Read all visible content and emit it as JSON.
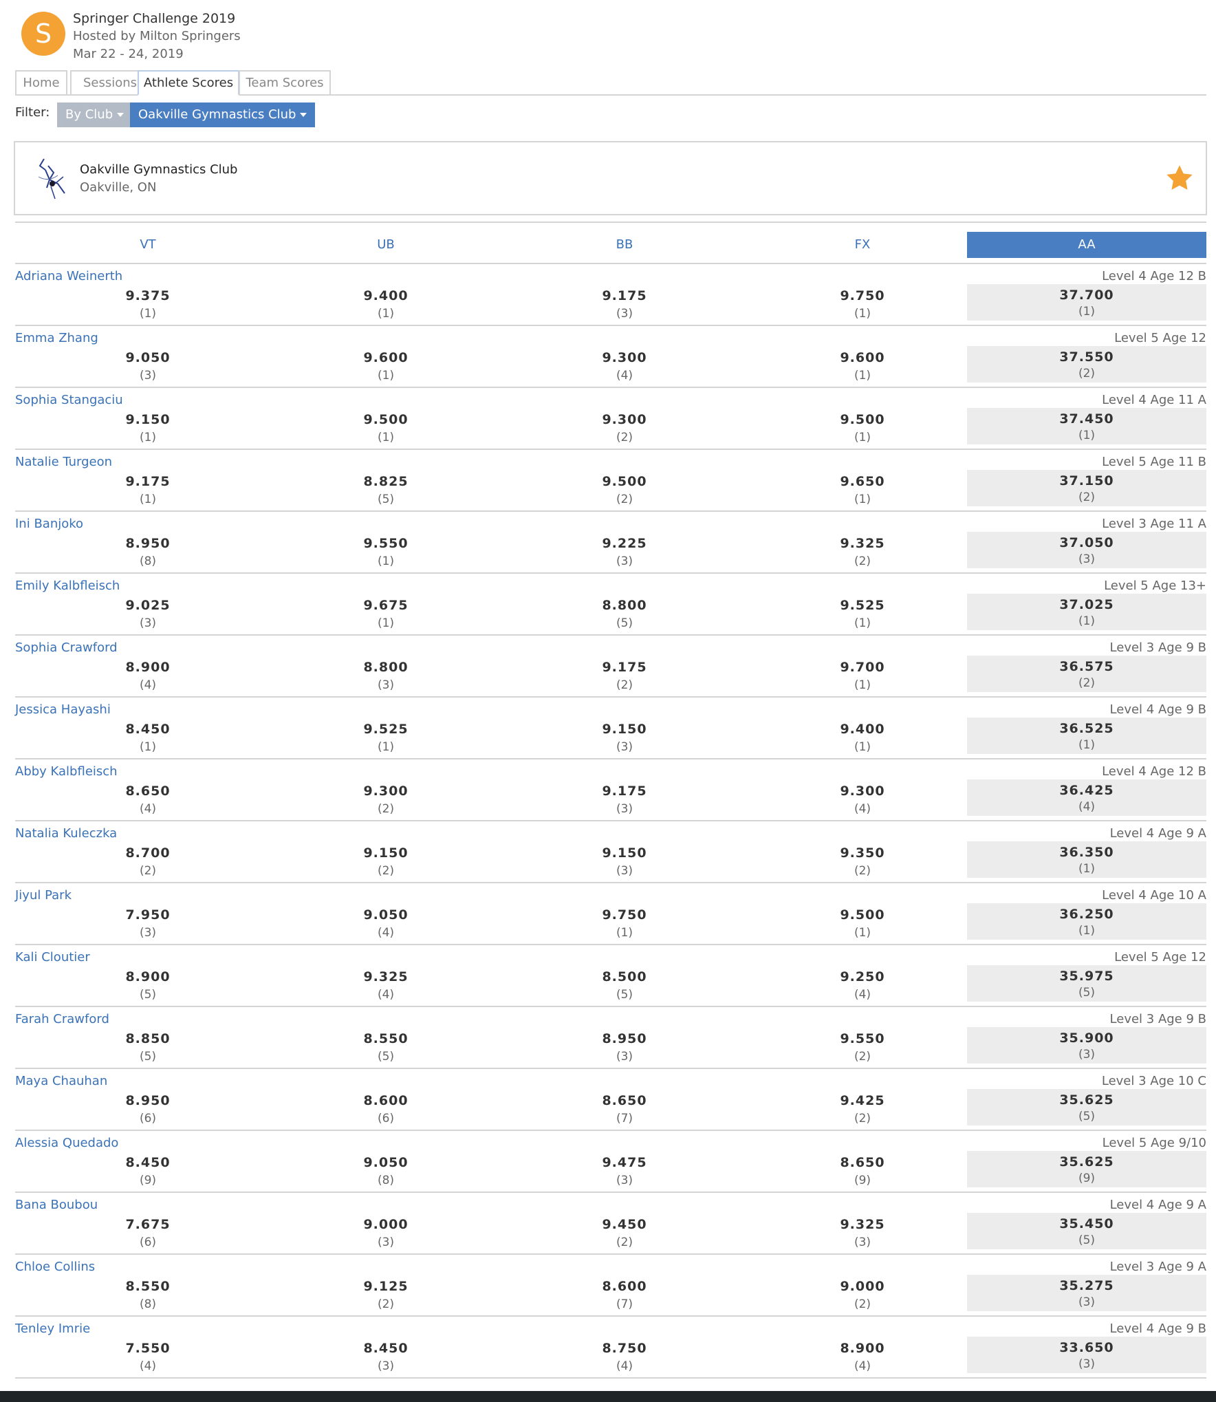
{
  "meet": {
    "logo_letter": "S",
    "title": "Springer Challenge 2019",
    "host": "Hosted by Milton Springers",
    "dates": "Mar 22 - 24, 2019"
  },
  "tabs": [
    {
      "label": "Home",
      "active": false
    },
    {
      "label": "Sessions",
      "active": false
    },
    {
      "label": "Athlete Scores",
      "active": true
    },
    {
      "label": "Team Scores",
      "active": false
    }
  ],
  "filter": {
    "label": "Filter:",
    "by": "By Club",
    "club": "Oakville Gymnastics Club"
  },
  "club": {
    "name": "Oakville Gymnastics Club",
    "location": "Oakville, ON",
    "favorite": true
  },
  "columns": [
    "VT",
    "UB",
    "BB",
    "FX",
    "AA"
  ],
  "colors": {
    "accent": "#4a7ec2",
    "link": "#3a72b8",
    "star": "#f3a233",
    "logo": "#f3a233"
  },
  "athletes": [
    {
      "name": "Adriana Weinerth",
      "level": "Level 4 Age 12 B",
      "scores": [
        [
          "9.375",
          "(1)"
        ],
        [
          "9.400",
          "(1)"
        ],
        [
          "9.175",
          "(3)"
        ],
        [
          "9.750",
          "(1)"
        ],
        [
          "37.700",
          "(1)"
        ]
      ]
    },
    {
      "name": "Emma Zhang",
      "level": "Level 5 Age 12",
      "scores": [
        [
          "9.050",
          "(3)"
        ],
        [
          "9.600",
          "(1)"
        ],
        [
          "9.300",
          "(4)"
        ],
        [
          "9.600",
          "(1)"
        ],
        [
          "37.550",
          "(2)"
        ]
      ]
    },
    {
      "name": "Sophia Stangaciu",
      "level": "Level 4 Age 11 A",
      "scores": [
        [
          "9.150",
          "(1)"
        ],
        [
          "9.500",
          "(1)"
        ],
        [
          "9.300",
          "(2)"
        ],
        [
          "9.500",
          "(1)"
        ],
        [
          "37.450",
          "(1)"
        ]
      ]
    },
    {
      "name": "Natalie Turgeon",
      "level": "Level 5 Age 11 B",
      "scores": [
        [
          "9.175",
          "(1)"
        ],
        [
          "8.825",
          "(5)"
        ],
        [
          "9.500",
          "(2)"
        ],
        [
          "9.650",
          "(1)"
        ],
        [
          "37.150",
          "(2)"
        ]
      ]
    },
    {
      "name": "Ini Banjoko",
      "level": "Level 3 Age 11 A",
      "scores": [
        [
          "8.950",
          "(8)"
        ],
        [
          "9.550",
          "(1)"
        ],
        [
          "9.225",
          "(3)"
        ],
        [
          "9.325",
          "(2)"
        ],
        [
          "37.050",
          "(3)"
        ]
      ]
    },
    {
      "name": "Emily Kalbfleisch",
      "level": "Level 5 Age 13+",
      "scores": [
        [
          "9.025",
          "(3)"
        ],
        [
          "9.675",
          "(1)"
        ],
        [
          "8.800",
          "(5)"
        ],
        [
          "9.525",
          "(1)"
        ],
        [
          "37.025",
          "(1)"
        ]
      ]
    },
    {
      "name": "Sophia Crawford",
      "level": "Level 3 Age 9 B",
      "scores": [
        [
          "8.900",
          "(4)"
        ],
        [
          "8.800",
          "(3)"
        ],
        [
          "9.175",
          "(2)"
        ],
        [
          "9.700",
          "(1)"
        ],
        [
          "36.575",
          "(2)"
        ]
      ]
    },
    {
      "name": "Jessica Hayashi",
      "level": "Level 4 Age 9 B",
      "scores": [
        [
          "8.450",
          "(1)"
        ],
        [
          "9.525",
          "(1)"
        ],
        [
          "9.150",
          "(3)"
        ],
        [
          "9.400",
          "(1)"
        ],
        [
          "36.525",
          "(1)"
        ]
      ]
    },
    {
      "name": "Abby Kalbfleisch",
      "level": "Level 4 Age 12 B",
      "scores": [
        [
          "8.650",
          "(4)"
        ],
        [
          "9.300",
          "(2)"
        ],
        [
          "9.175",
          "(3)"
        ],
        [
          "9.300",
          "(4)"
        ],
        [
          "36.425",
          "(4)"
        ]
      ]
    },
    {
      "name": "Natalia Kuleczka",
      "level": "Level 4 Age 9 A",
      "scores": [
        [
          "8.700",
          "(2)"
        ],
        [
          "9.150",
          "(2)"
        ],
        [
          "9.150",
          "(3)"
        ],
        [
          "9.350",
          "(2)"
        ],
        [
          "36.350",
          "(1)"
        ]
      ]
    },
    {
      "name": "Jiyul Park",
      "level": "Level 4 Age 10 A",
      "scores": [
        [
          "7.950",
          "(3)"
        ],
        [
          "9.050",
          "(4)"
        ],
        [
          "9.750",
          "(1)"
        ],
        [
          "9.500",
          "(1)"
        ],
        [
          "36.250",
          "(1)"
        ]
      ]
    },
    {
      "name": "Kali Cloutier",
      "level": "Level 5 Age 12",
      "scores": [
        [
          "8.900",
          "(5)"
        ],
        [
          "9.325",
          "(4)"
        ],
        [
          "8.500",
          "(5)"
        ],
        [
          "9.250",
          "(4)"
        ],
        [
          "35.975",
          "(5)"
        ]
      ]
    },
    {
      "name": "Farah Crawford",
      "level": "Level 3 Age 9 B",
      "scores": [
        [
          "8.850",
          "(5)"
        ],
        [
          "8.550",
          "(5)"
        ],
        [
          "8.950",
          "(3)"
        ],
        [
          "9.550",
          "(2)"
        ],
        [
          "35.900",
          "(3)"
        ]
      ]
    },
    {
      "name": "Maya Chauhan",
      "level": "Level 3 Age 10 C",
      "scores": [
        [
          "8.950",
          "(6)"
        ],
        [
          "8.600",
          "(6)"
        ],
        [
          "8.650",
          "(7)"
        ],
        [
          "9.425",
          "(2)"
        ],
        [
          "35.625",
          "(5)"
        ]
      ]
    },
    {
      "name": "Alessia Quedado",
      "level": "Level 5 Age 9/10",
      "scores": [
        [
          "8.450",
          "(9)"
        ],
        [
          "9.050",
          "(8)"
        ],
        [
          "9.475",
          "(3)"
        ],
        [
          "8.650",
          "(9)"
        ],
        [
          "35.625",
          "(9)"
        ]
      ]
    },
    {
      "name": "Bana Boubou",
      "level": "Level 4 Age 9 A",
      "scores": [
        [
          "7.675",
          "(6)"
        ],
        [
          "9.000",
          "(3)"
        ],
        [
          "9.450",
          "(2)"
        ],
        [
          "9.325",
          "(3)"
        ],
        [
          "35.450",
          "(5)"
        ]
      ]
    },
    {
      "name": "Chloe Collins",
      "level": "Level 3 Age 9 A",
      "scores": [
        [
          "8.550",
          "(8)"
        ],
        [
          "9.125",
          "(2)"
        ],
        [
          "8.600",
          "(7)"
        ],
        [
          "9.000",
          "(2)"
        ],
        [
          "35.275",
          "(3)"
        ]
      ]
    },
    {
      "name": "Tenley Imrie",
      "level": "Level 4 Age 9 B",
      "scores": [
        [
          "7.550",
          "(4)"
        ],
        [
          "8.450",
          "(3)"
        ],
        [
          "8.750",
          "(4)"
        ],
        [
          "8.900",
          "(4)"
        ],
        [
          "33.650",
          "(3)"
        ]
      ]
    }
  ]
}
